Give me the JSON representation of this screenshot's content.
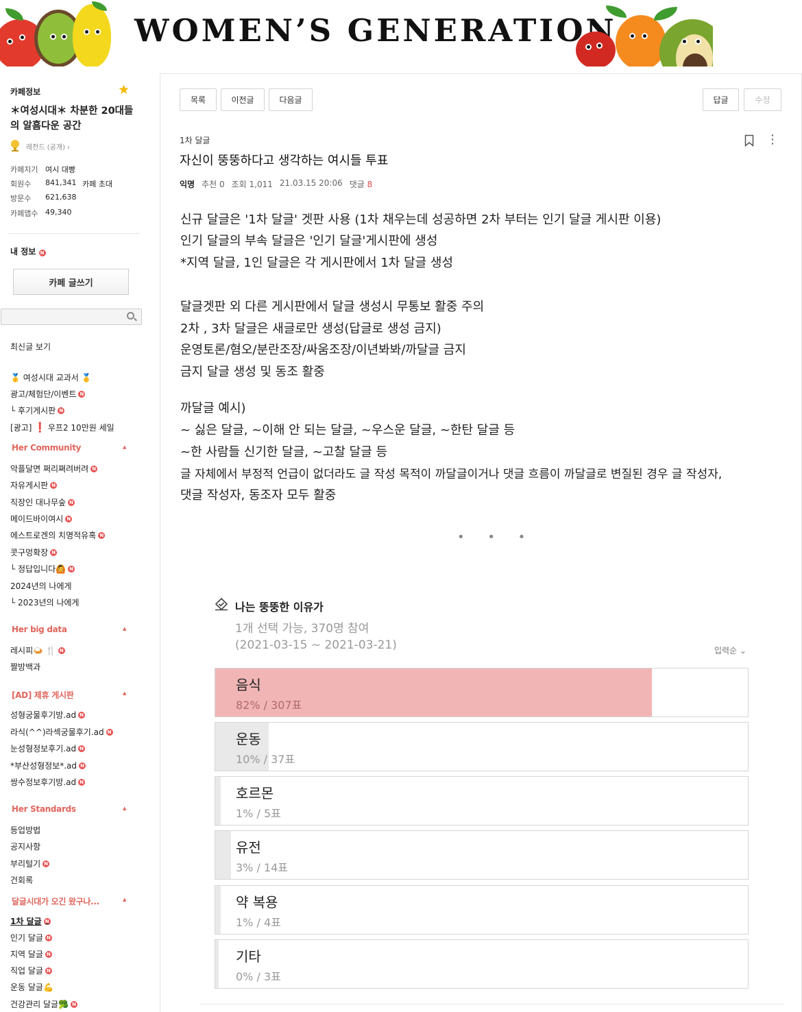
{
  "banner": {
    "title": "WOMEN’S GENERATION"
  },
  "sidebar": {
    "cafe_label": "카페정보",
    "cafe_name": "＊여성시대＊ 차분한 20대들의 알흠다운 공간",
    "grade": "레전드 (공개) ›",
    "info": [
      {
        "label": "카페지기",
        "value": "여시 대빵"
      },
      {
        "label": "회원수",
        "value": "841,341",
        "extra": "카페 초대"
      },
      {
        "label": "방문수",
        "value": "621,638"
      },
      {
        "label": "카페앱수",
        "value": "49,340"
      }
    ],
    "my_info": "내 정보",
    "write_button": "카페 글쓰기",
    "search": {
      "placeholder": ""
    },
    "latest": "최신글 보기",
    "menus_top": [
      {
        "label": "🥇 여성시대 교과서 🥇",
        "badge": false
      },
      {
        "label": "광고/체험단/이벤트",
        "badge": true
      },
      {
        "label": "└ 후기게시판",
        "badge": true
      },
      {
        "label": "우프2 10만원 세일",
        "prefix": "[광고]",
        "badge": false
      }
    ],
    "group1": {
      "title": "Her Community",
      "items": [
        {
          "label": "악플달면 쩌리쪄려버려",
          "badge": true
        },
        {
          "label": "자유게시판",
          "badge": true
        },
        {
          "label": "직장인 대나무숲",
          "badge": true
        },
        {
          "label": "메이드바이여시",
          "badge": true
        },
        {
          "label": "에스트로겐의 치명적유혹",
          "badge": true
        },
        {
          "label": "콧구멍확장",
          "badge": true
        },
        {
          "label": "└ 정답입니다🙆",
          "badge": true
        },
        {
          "label": "2024년의 나에게",
          "badge": false
        },
        {
          "label": "└ 2023년의 나에게",
          "badge": false
        }
      ]
    },
    "group2": {
      "title": "Her big data",
      "items": [
        {
          "label": "레시피🍛 🍴",
          "badge": true
        },
        {
          "label": "짤방백과",
          "badge": false
        }
      ]
    },
    "group3": {
      "title": "[AD] 제휴 게시판",
      "items": [
        {
          "label": "성형궁물후기방.ad",
          "badge": true
        },
        {
          "label": "라식(^^)라섹궁물후기.ad",
          "badge": true
        },
        {
          "label": "눈성형정보후기.ad",
          "badge": true
        },
        {
          "label": "*부산성형정보*.ad",
          "badge": true
        },
        {
          "label": "쌍수정보후기방.ad",
          "badge": true
        }
      ]
    },
    "group4": {
      "title": "Her Standards",
      "items": [
        {
          "label": "등업방법",
          "badge": false
        },
        {
          "label": "공지사항",
          "badge": false
        },
        {
          "label": "부리털기",
          "badge": true
        },
        {
          "label": "건회록",
          "badge": false
        }
      ]
    },
    "group5": {
      "title": "달글시대가 오긴 왔구나...",
      "items": [
        {
          "label": "1차 달글",
          "badge": true,
          "active": true
        },
        {
          "label": "인기 달글",
          "badge": true
        },
        {
          "label": "지역 달글",
          "badge": true
        },
        {
          "label": "직업 달글",
          "badge": true
        },
        {
          "label": "운동 달글💪",
          "badge": false
        },
        {
          "label": "건강관리 달글🥦",
          "badge": true
        }
      ]
    },
    "badge_text": "N"
  },
  "toolbar": {
    "list": "목록",
    "prev": "이전글",
    "next": "다음글",
    "reply": "답글",
    "edit": "수정"
  },
  "article": {
    "board": "1차 달글",
    "title": "자신이 뚱뚱하다고 생각하는 여시들 투표",
    "author": "익명",
    "recommend": "추천 0",
    "views": "조회 1,011",
    "date": "21.03.15 20:06",
    "comments_label": "댓글",
    "comments_count": "8",
    "body": [
      "신규 달글은 '1차 달글' 겟판 사용 (1차 채우는데 성공하면 2차 부터는 인기 달글 게시판 이용)",
      "인기 달글의 부속 달글은 '인기 달글'게시판에 생성",
      "*지역 달글, 1인 달글은 각 게시판에서 1차 달글 생성",
      "달글겟판 외 다른 게시판에서 달글 생성시 무통보 활중 주의",
      "2차 , 3차 달글은 새글로만 생성(답글로 생성 금지)",
      "운영토론/혐오/분란조장/싸움조장/이년봐봐/까달글 금지",
      "금지 달글 생성 및 동조 활중",
      "까달글 예시)",
      "~ 싫은 달글, ~이해 안 되는 달글, ~우스운 달글, ~한탄 달글 등",
      "~한 사람들 신기한 달글, ~고찰 달글 등",
      "글 자체에서 부정적 언급이 없더라도 글 작성 목적이 까달글이거나 댓글 흐름이 까달글로 변질된 경우 글 작성자,",
      "댓글 작성자, 동조자 모두 활중"
    ],
    "dots": "• • •"
  },
  "poll": {
    "title": "나는 뚱뚱한 이유가",
    "info": "1개 선택 가능, 370명 참여",
    "period": "(2021-03-15 ~ 2021-03-21)",
    "sort": "입력순 ⌄",
    "options": [
      {
        "name": "음식",
        "stat": "82% / 307표",
        "percent": 82
      },
      {
        "name": "운동",
        "stat": "10% / 37표",
        "percent": 10
      },
      {
        "name": "호르몬",
        "stat": "1% / 5표",
        "percent": 1
      },
      {
        "name": "유전",
        "stat": "3% / 14표",
        "percent": 3
      },
      {
        "name": "약 복용",
        "stat": "1% / 4표",
        "percent": 1
      },
      {
        "name": "기타",
        "stat": "0% / 3표",
        "percent": 0
      }
    ],
    "colors": {
      "winner_fill": "#f1b5b5",
      "fill": "#e9e9e9"
    }
  }
}
